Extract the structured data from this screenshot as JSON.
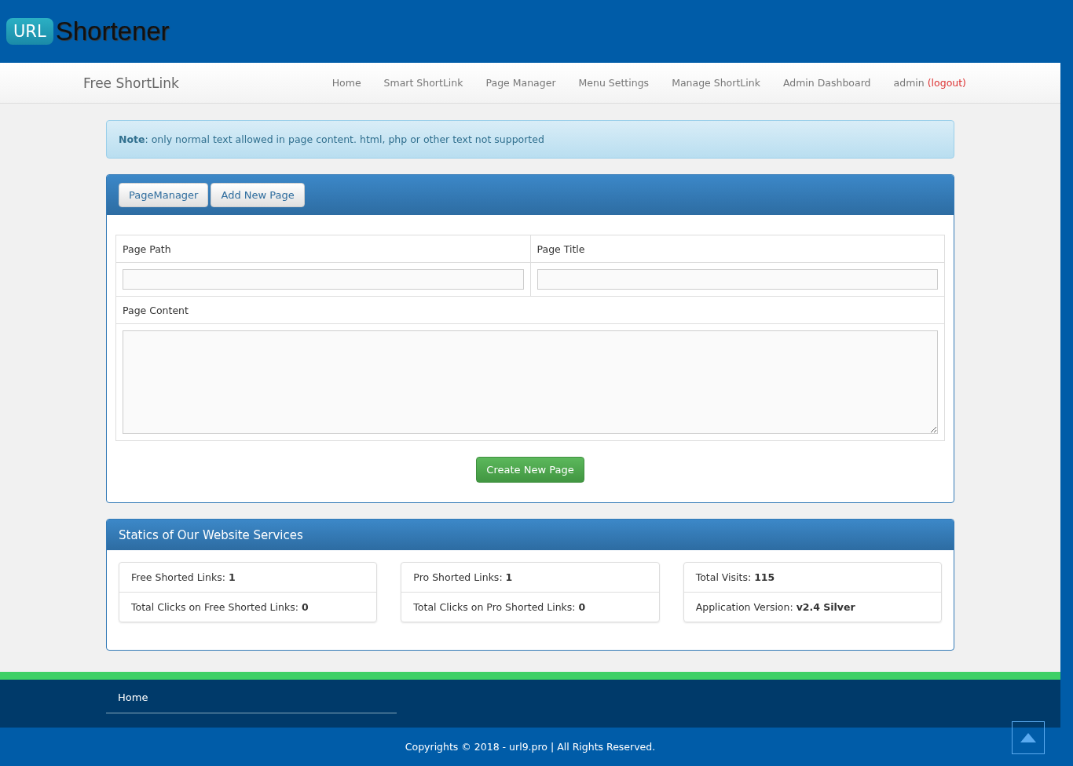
{
  "logo": {
    "badge": "URL",
    "text": "Shortener"
  },
  "navbar": {
    "brand": "Free ShortLink",
    "items": [
      {
        "label": "Home"
      },
      {
        "label": "Smart ShortLink"
      },
      {
        "label": "Page Manager"
      },
      {
        "label": "Menu Settings"
      },
      {
        "label": "Manage ShortLink"
      },
      {
        "label": "Admin Dashboard"
      }
    ],
    "user": "admin",
    "logout": "(logout)"
  },
  "note": "**Note**: only normal text allowed in page content. html, php or other text not supported",
  "page_panel": {
    "buttons": [
      "PageManager",
      "Add New Page"
    ],
    "fields": [
      {
        "label": "Page Path"
      },
      {
        "label": "Page Title"
      }
    ],
    "content_label": "Page Content",
    "submit": "Create New Page"
  },
  "stats": {
    "title": "Statics of Our Website Services",
    "cards": [
      [
        "Free Shorted Links: **1**",
        "Total Clicks on Free Shorted Links: **0**"
      ],
      [
        "Pro Shorted Links: **1**",
        "Total Clicks on Pro Shorted Links: **0**"
      ],
      [
        "Total Visits: **115**",
        "Application Version: **v2.4 Silver**"
      ]
    ]
  },
  "footer": {
    "links": [
      "Home"
    ],
    "copyright": "Copyrights © 2018 - url9.pro | All Rights Reserved."
  }
}
